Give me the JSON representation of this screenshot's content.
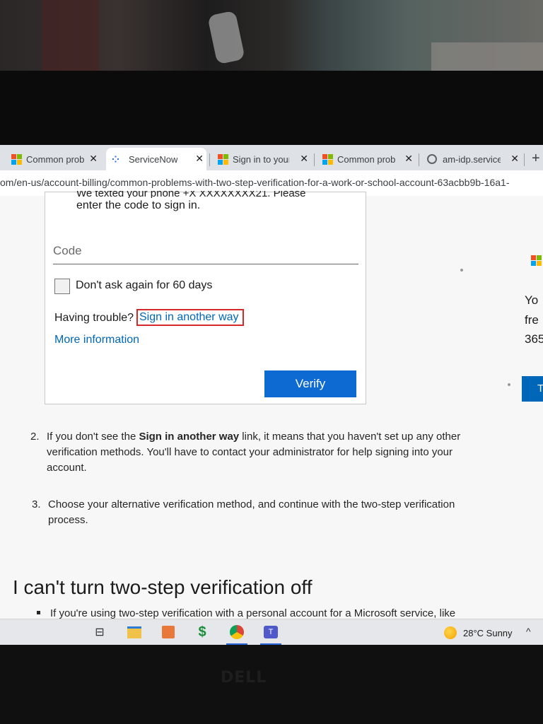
{
  "browser": {
    "tabs": [
      {
        "title": "Common prob",
        "icon": "microsoft-logo-icon",
        "close": "✕"
      },
      {
        "title": "ServiceNow",
        "icon": "servicenow-icon",
        "close": "✕"
      },
      {
        "title": "Sign in to your",
        "icon": "microsoft-logo-icon",
        "close": "✕"
      },
      {
        "title": "Common prob",
        "icon": "microsoft-logo-icon",
        "close": "✕"
      },
      {
        "title": "am-idp.service",
        "icon": "globe-icon",
        "close": "✕"
      }
    ],
    "new_tab": "+",
    "url": "om/en-us/account-billing/common-problems-with-two-step-verification-for-a-work-or-school-account-63acbb9b-16a1-"
  },
  "signin_card": {
    "message_line1": "We texted your phone +X XXXXXXXX21. Please",
    "message_line2": "enter the code to sign in.",
    "code_placeholder": "Code",
    "dont_ask_label": "Don't ask again for 60 days",
    "trouble_label": "Having trouble?",
    "sign_in_another_way": "Sign in another way",
    "more_information": "More information",
    "verify_button": "Verify"
  },
  "side_panel": {
    "line1": "Yo",
    "line2": "fre",
    "line3": "365",
    "button": "T"
  },
  "steps": [
    {
      "num": "2.",
      "pre": "If you don't see the ",
      "bold": "Sign in another way",
      "post": " link, it means that you haven't set up any other",
      "line2": "verification methods. You'll have to contact your administrator for help signing into your",
      "line3": "account."
    },
    {
      "num": "3.",
      "line1": "Choose your alternative verification method, and continue with the two-step verification",
      "line2": "process."
    }
  ],
  "section_heading": "I can't turn two-step verification off",
  "bullet_text": "If you're using two-step verification with a personal account for a Microsoft service, like",
  "taskbar": {
    "weather_temp": "28°C",
    "weather_desc": "Sunny",
    "tray_caret": "^"
  },
  "laptop_brand": "DELL",
  "colors": {
    "link": "#0067b8",
    "verify": "#0d6ad3",
    "highlight_box": "#d62a2a"
  }
}
